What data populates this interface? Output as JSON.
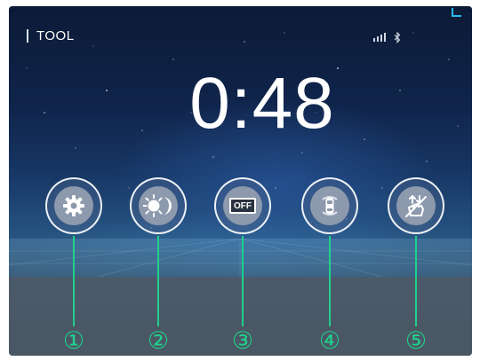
{
  "header": {
    "title": "TOOL"
  },
  "status_icons": [
    {
      "name": "signal-icon"
    },
    {
      "name": "bluetooth-icon"
    }
  ],
  "clock": {
    "time": "0:48"
  },
  "tools": [
    {
      "name": "settings",
      "icon": "gear-icon"
    },
    {
      "name": "day-night-mode",
      "icon": "sun-moon-icon"
    },
    {
      "name": "screen-off",
      "icon": "off-icon",
      "icon_text": "OFF"
    },
    {
      "name": "parking-sensor",
      "icon": "car-sensor-icon"
    },
    {
      "name": "gesture-disable",
      "icon": "gesture-off-icon"
    }
  ],
  "callouts": [
    "①",
    "②",
    "③",
    "④",
    "⑤"
  ],
  "colors": {
    "callout": "#1fd18a",
    "screen_background": "#10254c",
    "text": "#ffffff"
  }
}
